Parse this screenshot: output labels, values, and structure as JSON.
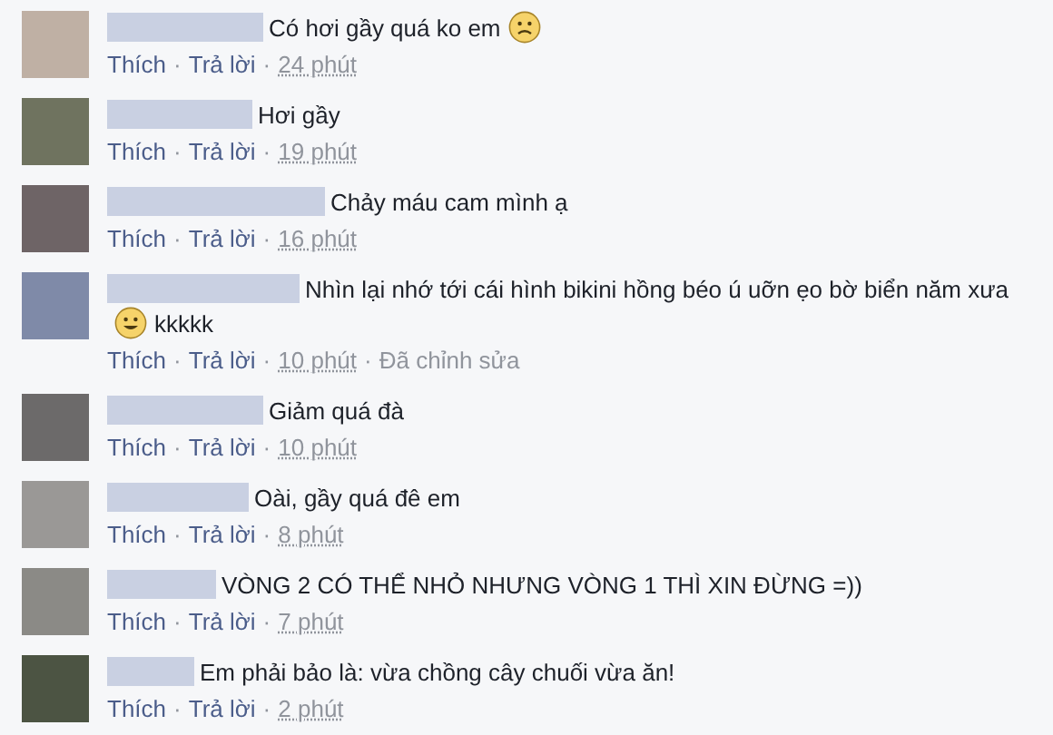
{
  "comments": [
    {
      "parts": [
        {
          "kind": "text",
          "text": "Có hơi gầy quá ko em"
        },
        {
          "kind": "frown"
        }
      ],
      "actions": [
        {
          "kind": "link",
          "text": "Thích"
        },
        {
          "kind": "sep",
          "text": "·"
        },
        {
          "kind": "link",
          "text": "Trả lời"
        },
        {
          "kind": "sep",
          "text": "·"
        },
        {
          "kind": "time",
          "text": "24 phút"
        }
      ]
    },
    {
      "parts": [
        {
          "kind": "text",
          "text": "Hơi gầy"
        }
      ],
      "actions": [
        {
          "kind": "link",
          "text": "Thích"
        },
        {
          "kind": "sep",
          "text": "·"
        },
        {
          "kind": "link",
          "text": "Trả lời"
        },
        {
          "kind": "sep",
          "text": "·"
        },
        {
          "kind": "time",
          "text": "19 phút"
        }
      ]
    },
    {
      "parts": [
        {
          "kind": "text",
          "text": "Chảy máu cam mình ạ"
        }
      ],
      "actions": [
        {
          "kind": "link",
          "text": "Thích"
        },
        {
          "kind": "sep",
          "text": "·"
        },
        {
          "kind": "link",
          "text": "Trả lời"
        },
        {
          "kind": "sep",
          "text": "·"
        },
        {
          "kind": "time",
          "text": "16 phút"
        }
      ]
    },
    {
      "parts": [
        {
          "kind": "text",
          "text": "Nhìn lại nhớ tới cái hình bikini hồng béo ú uỡn ẹo bờ biển năm xưa"
        },
        {
          "kind": "smile"
        },
        {
          "kind": "text",
          "text": "kkkkk"
        }
      ],
      "actions": [
        {
          "kind": "link",
          "text": "Thích"
        },
        {
          "kind": "sep",
          "text": "·"
        },
        {
          "kind": "link",
          "text": "Trả lời"
        },
        {
          "kind": "sep",
          "text": "·"
        },
        {
          "kind": "time",
          "text": "10 phút"
        },
        {
          "kind": "sep",
          "text": "·"
        },
        {
          "kind": "note",
          "text": "Đã chỉnh sửa"
        }
      ]
    },
    {
      "parts": [
        {
          "kind": "text",
          "text": "Giảm quá đà"
        }
      ],
      "actions": [
        {
          "kind": "link",
          "text": "Thích"
        },
        {
          "kind": "sep",
          "text": "·"
        },
        {
          "kind": "link",
          "text": "Trả lời"
        },
        {
          "kind": "sep",
          "text": "·"
        },
        {
          "kind": "time",
          "text": "10 phút"
        }
      ]
    },
    {
      "parts": [
        {
          "kind": "text",
          "text": "Oài, gầy quá đê em"
        }
      ],
      "actions": [
        {
          "kind": "link",
          "text": "Thích"
        },
        {
          "kind": "sep",
          "text": "·"
        },
        {
          "kind": "link",
          "text": "Trả lời"
        },
        {
          "kind": "sep",
          "text": "·"
        },
        {
          "kind": "time",
          "text": "8 phút"
        }
      ]
    },
    {
      "parts": [
        {
          "kind": "text",
          "text": "VÒNG 2 CÓ THỂ NHỎ NHƯNG VÒNG 1 THÌ XIN ĐỪNG =))"
        }
      ],
      "actions": [
        {
          "kind": "link",
          "text": "Thích"
        },
        {
          "kind": "sep",
          "text": "·"
        },
        {
          "kind": "link",
          "text": "Trả lời"
        },
        {
          "kind": "sep",
          "text": "·"
        },
        {
          "kind": "time",
          "text": "7 phút"
        }
      ]
    },
    {
      "parts": [
        {
          "kind": "text",
          "text": "Em phải bảo là: vừa chồng cây chuối vừa ăn!"
        }
      ],
      "actions": [
        {
          "kind": "link",
          "text": "Thích"
        },
        {
          "kind": "sep",
          "text": "·"
        },
        {
          "kind": "link",
          "text": "Trả lời"
        },
        {
          "kind": "sep",
          "text": "·"
        },
        {
          "kind": "time",
          "text": "2 phút"
        }
      ]
    }
  ]
}
